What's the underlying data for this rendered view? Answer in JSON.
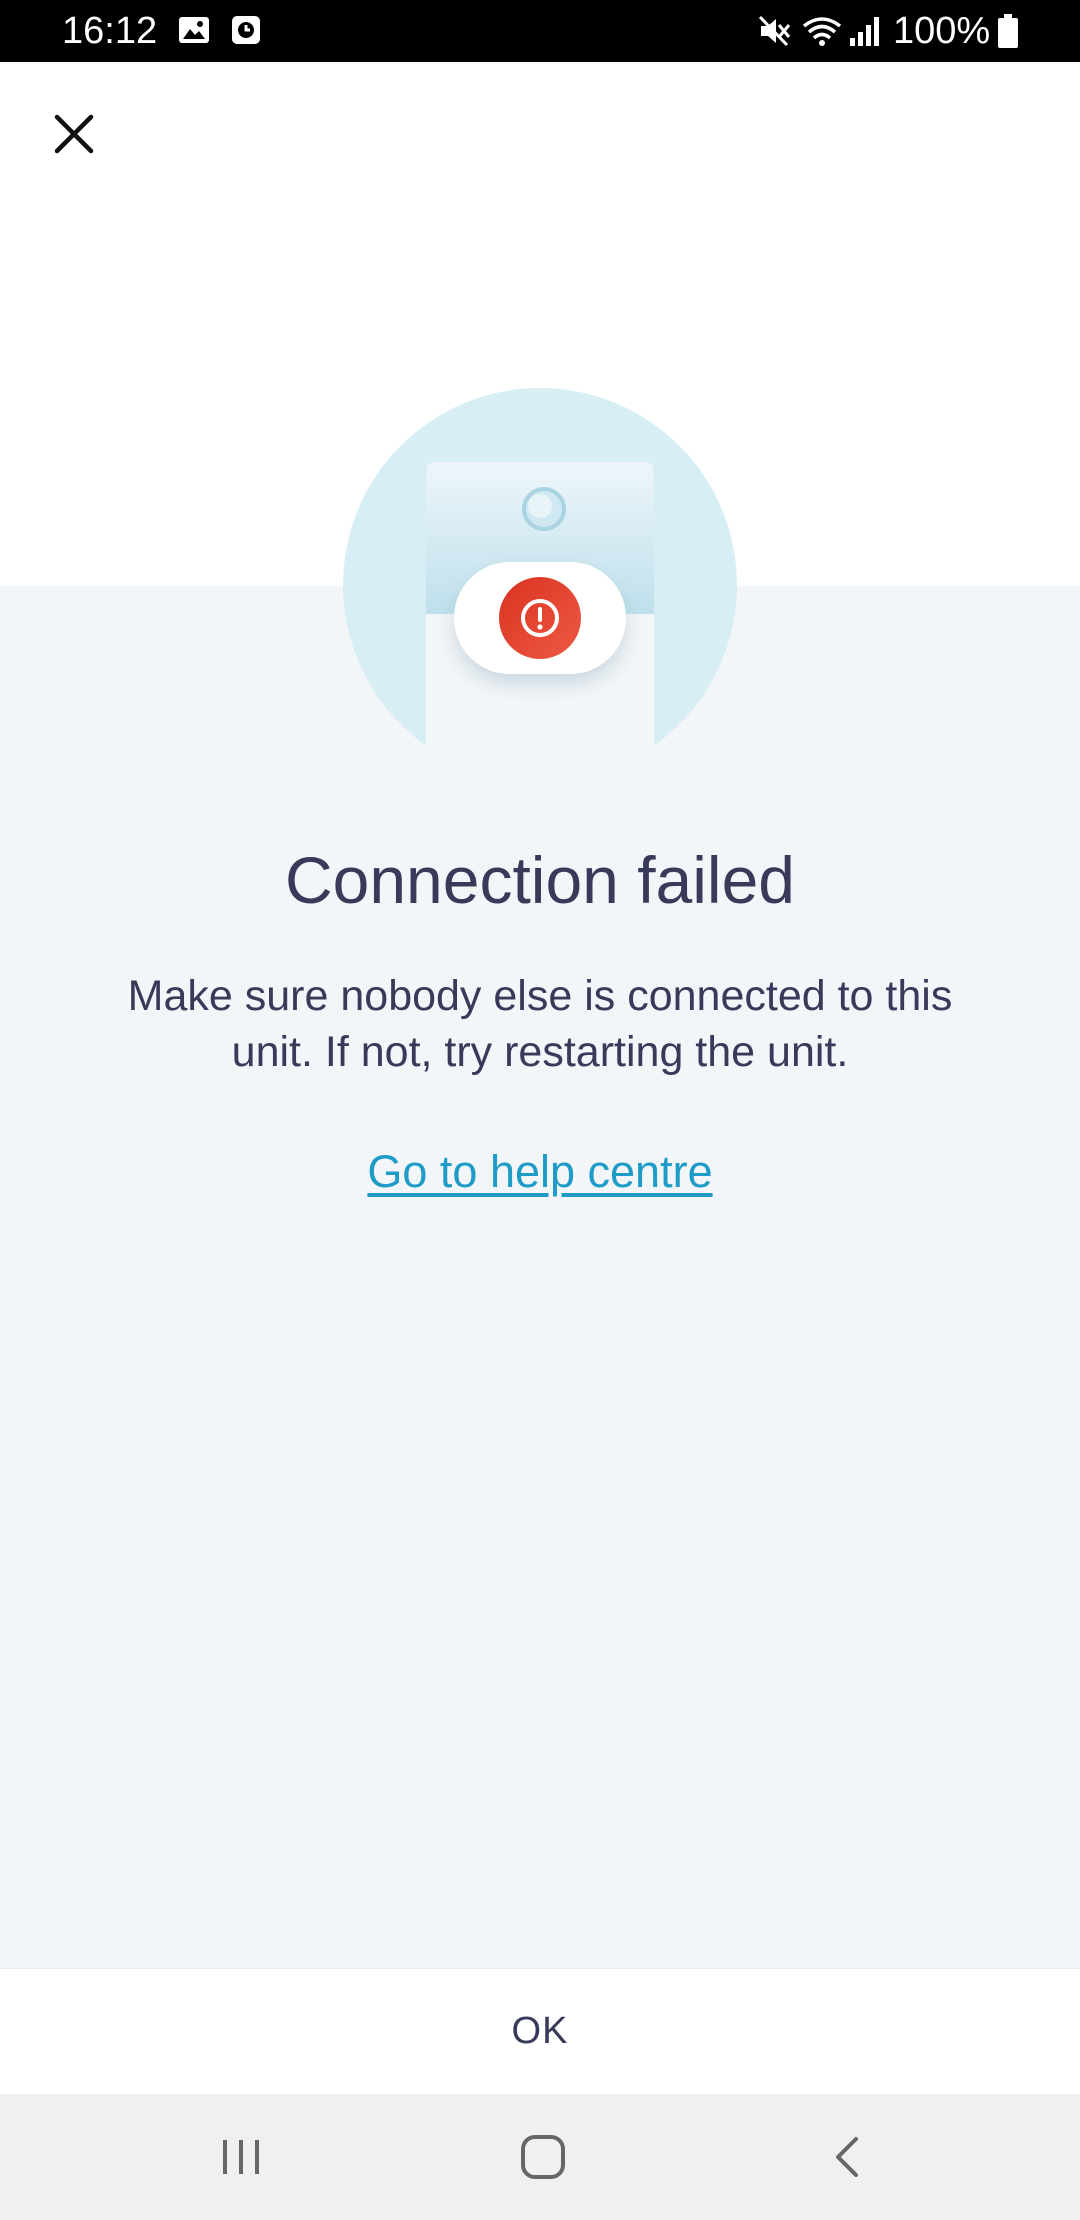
{
  "status_bar": {
    "time": "16:12",
    "battery": "100%",
    "icons": [
      "gallery-icon",
      "clock-icon",
      "mute-icon",
      "wifi-icon",
      "signal-icon",
      "battery-icon"
    ]
  },
  "header": {
    "close_icon": "close-icon"
  },
  "illustration": {
    "icon": "error-alert-icon",
    "accent_color": "#e03c2e",
    "circle_color": "#d8eef5"
  },
  "dialog": {
    "title": "Connection failed",
    "message": "Make sure nobody else is connected to this unit. If not, try restarting the unit.",
    "help_link": "Go to help centre"
  },
  "footer": {
    "ok_label": "OK"
  },
  "nav_bar": {
    "items": [
      "recent-apps-icon",
      "home-icon",
      "back-icon"
    ]
  },
  "colors": {
    "text": "#383a5a",
    "link": "#1e9bc7",
    "background": "#f3f6f9"
  }
}
